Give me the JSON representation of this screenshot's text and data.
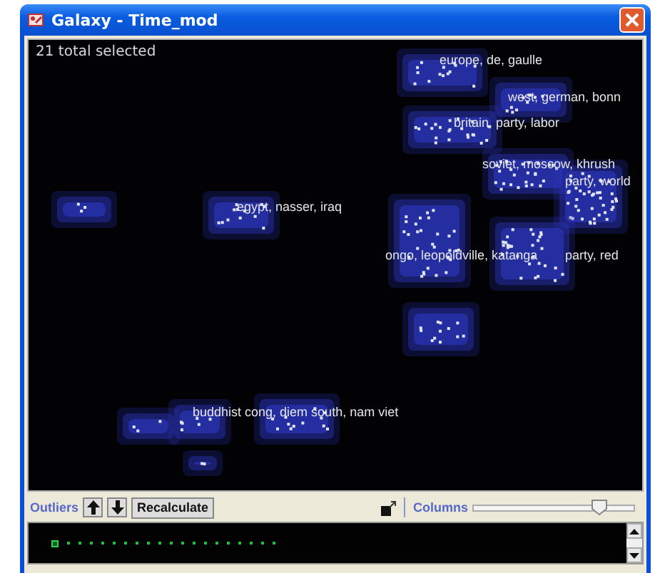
{
  "window": {
    "title": "Galaxy - Time_mod"
  },
  "selection_count": "21 total selected",
  "clusters": [
    {
      "label": "europe, de, gaulle"
    },
    {
      "label": "west, german, bonn"
    },
    {
      "label": "britain, party, labor"
    },
    {
      "label": "soviet, moscow, khrush"
    },
    {
      "label": "party, world"
    },
    {
      "label": "egypt, nasser, iraq"
    },
    {
      "label": "ongo, leopoldville, katanga"
    },
    {
      "label": "party, red"
    },
    {
      "label": "buddhist cong, diem south, nam viet"
    }
  ],
  "toolbar": {
    "outliers_label": "Outliers",
    "recalculate": "Recalculate",
    "columns_label": "Columns",
    "columns_slider": {
      "level": 0.78
    }
  },
  "outliers": [
    {
      "selected": true
    },
    {
      "selected": false
    },
    {
      "selected": false
    },
    {
      "selected": false
    },
    {
      "selected": false
    },
    {
      "selected": false
    },
    {
      "selected": false
    },
    {
      "selected": false
    },
    {
      "selected": false
    },
    {
      "selected": false
    },
    {
      "selected": false
    },
    {
      "selected": false
    },
    {
      "selected": false
    },
    {
      "selected": false
    },
    {
      "selected": false
    },
    {
      "selected": false
    },
    {
      "selected": false
    },
    {
      "selected": false
    },
    {
      "selected": false
    },
    {
      "selected": false
    }
  ]
}
